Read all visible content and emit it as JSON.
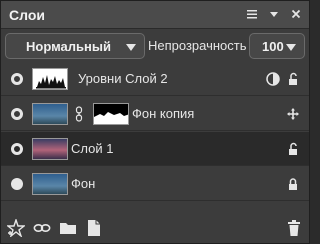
{
  "panel": {
    "title": "Слои"
  },
  "toolbar": {
    "icons": [
      "menu-icon",
      "collapse-icon",
      "close-icon"
    ]
  },
  "blend": {
    "mode": "Нормальный",
    "opacity_label": "Непрозрачность",
    "opacity_value": "100"
  },
  "layers": [
    {
      "name": "Уровни Слой 2",
      "visible": true,
      "locked": false
    },
    {
      "name": "Фон копия",
      "visible": true,
      "locked": false
    },
    {
      "name": "Слой 1",
      "visible": true,
      "locked": false,
      "selected": true
    },
    {
      "name": "Фон",
      "visible": true,
      "locked": true
    }
  ],
  "colors": {
    "panel_bg": "#3c3c3c",
    "titlebar_bg": "#4b4b4b",
    "selected_row": "#2a2a2a",
    "text": "#e6e6e6"
  },
  "bottom_icons": [
    "add-style-icon",
    "link-icon",
    "folder-icon",
    "new-layer-icon",
    "trash-icon"
  ]
}
